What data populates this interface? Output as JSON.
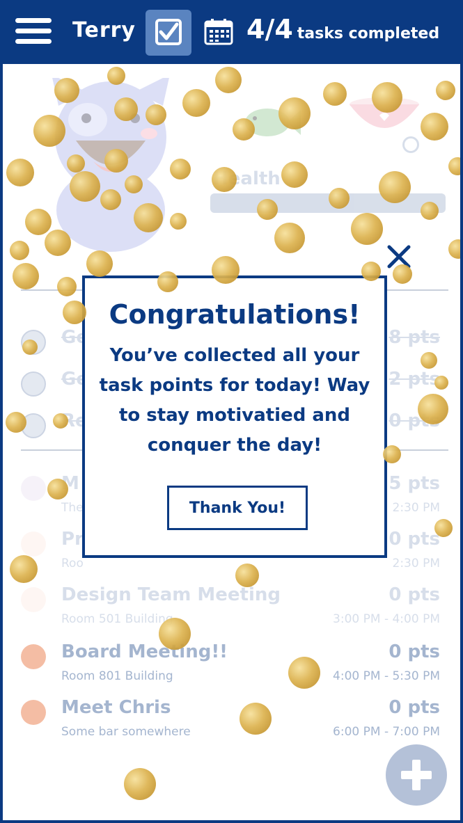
{
  "header": {
    "user_name": "Terry",
    "task_count": "4/4",
    "task_count_label": "tasks completed",
    "menu_icon": "hamburger-menu-icon",
    "checklist_icon": "checkbox-icon",
    "calendar_icon": "calendar-icon"
  },
  "pet": {
    "health_label": "Health"
  },
  "tasks": [
    {
      "title": "Ge",
      "points": "8 pts",
      "done": true
    },
    {
      "title": "Ge",
      "points": "2 pts",
      "done": true
    },
    {
      "title": "Re",
      "points": "0 pts",
      "done": true
    },
    {
      "title": "M",
      "subtitle": "The",
      "points": "5 pts",
      "time": "2:30 PM"
    },
    {
      "title": "Pr",
      "subtitle": "Roo",
      "points": "0 pts",
      "time": "2:30 PM"
    },
    {
      "title": "Design Team Meeting",
      "subtitle": "Room 501 Building",
      "points": "0 pts",
      "time": "3:00 PM - 4:00 PM"
    },
    {
      "title": "Board Meeting!!",
      "subtitle": "Room 801 Building",
      "points": "0 pts",
      "time": "4:00 PM - 5:30 PM"
    },
    {
      "title": "Meet Chris",
      "subtitle": "Some bar somewhere",
      "points": "0 pts",
      "time": "6:00 PM - 7:00 PM"
    }
  ],
  "modal": {
    "title": "Congratulations!",
    "message": "You’ve collected all your task points for today! Way to stay motivatied and conquer the day!",
    "button_label": "Thank You!",
    "close_icon": "close-icon"
  },
  "add_button_icon": "plus-icon",
  "colors": {
    "primary": "#0b3a82",
    "muted": "#8ea3c4",
    "done_dot": "#b4c1d8",
    "purple_dot": "#e6dcef",
    "pink_dot": "#fde6df",
    "orange_dot": "#f2ad8e",
    "confetti_gold": "#dcb24e"
  }
}
